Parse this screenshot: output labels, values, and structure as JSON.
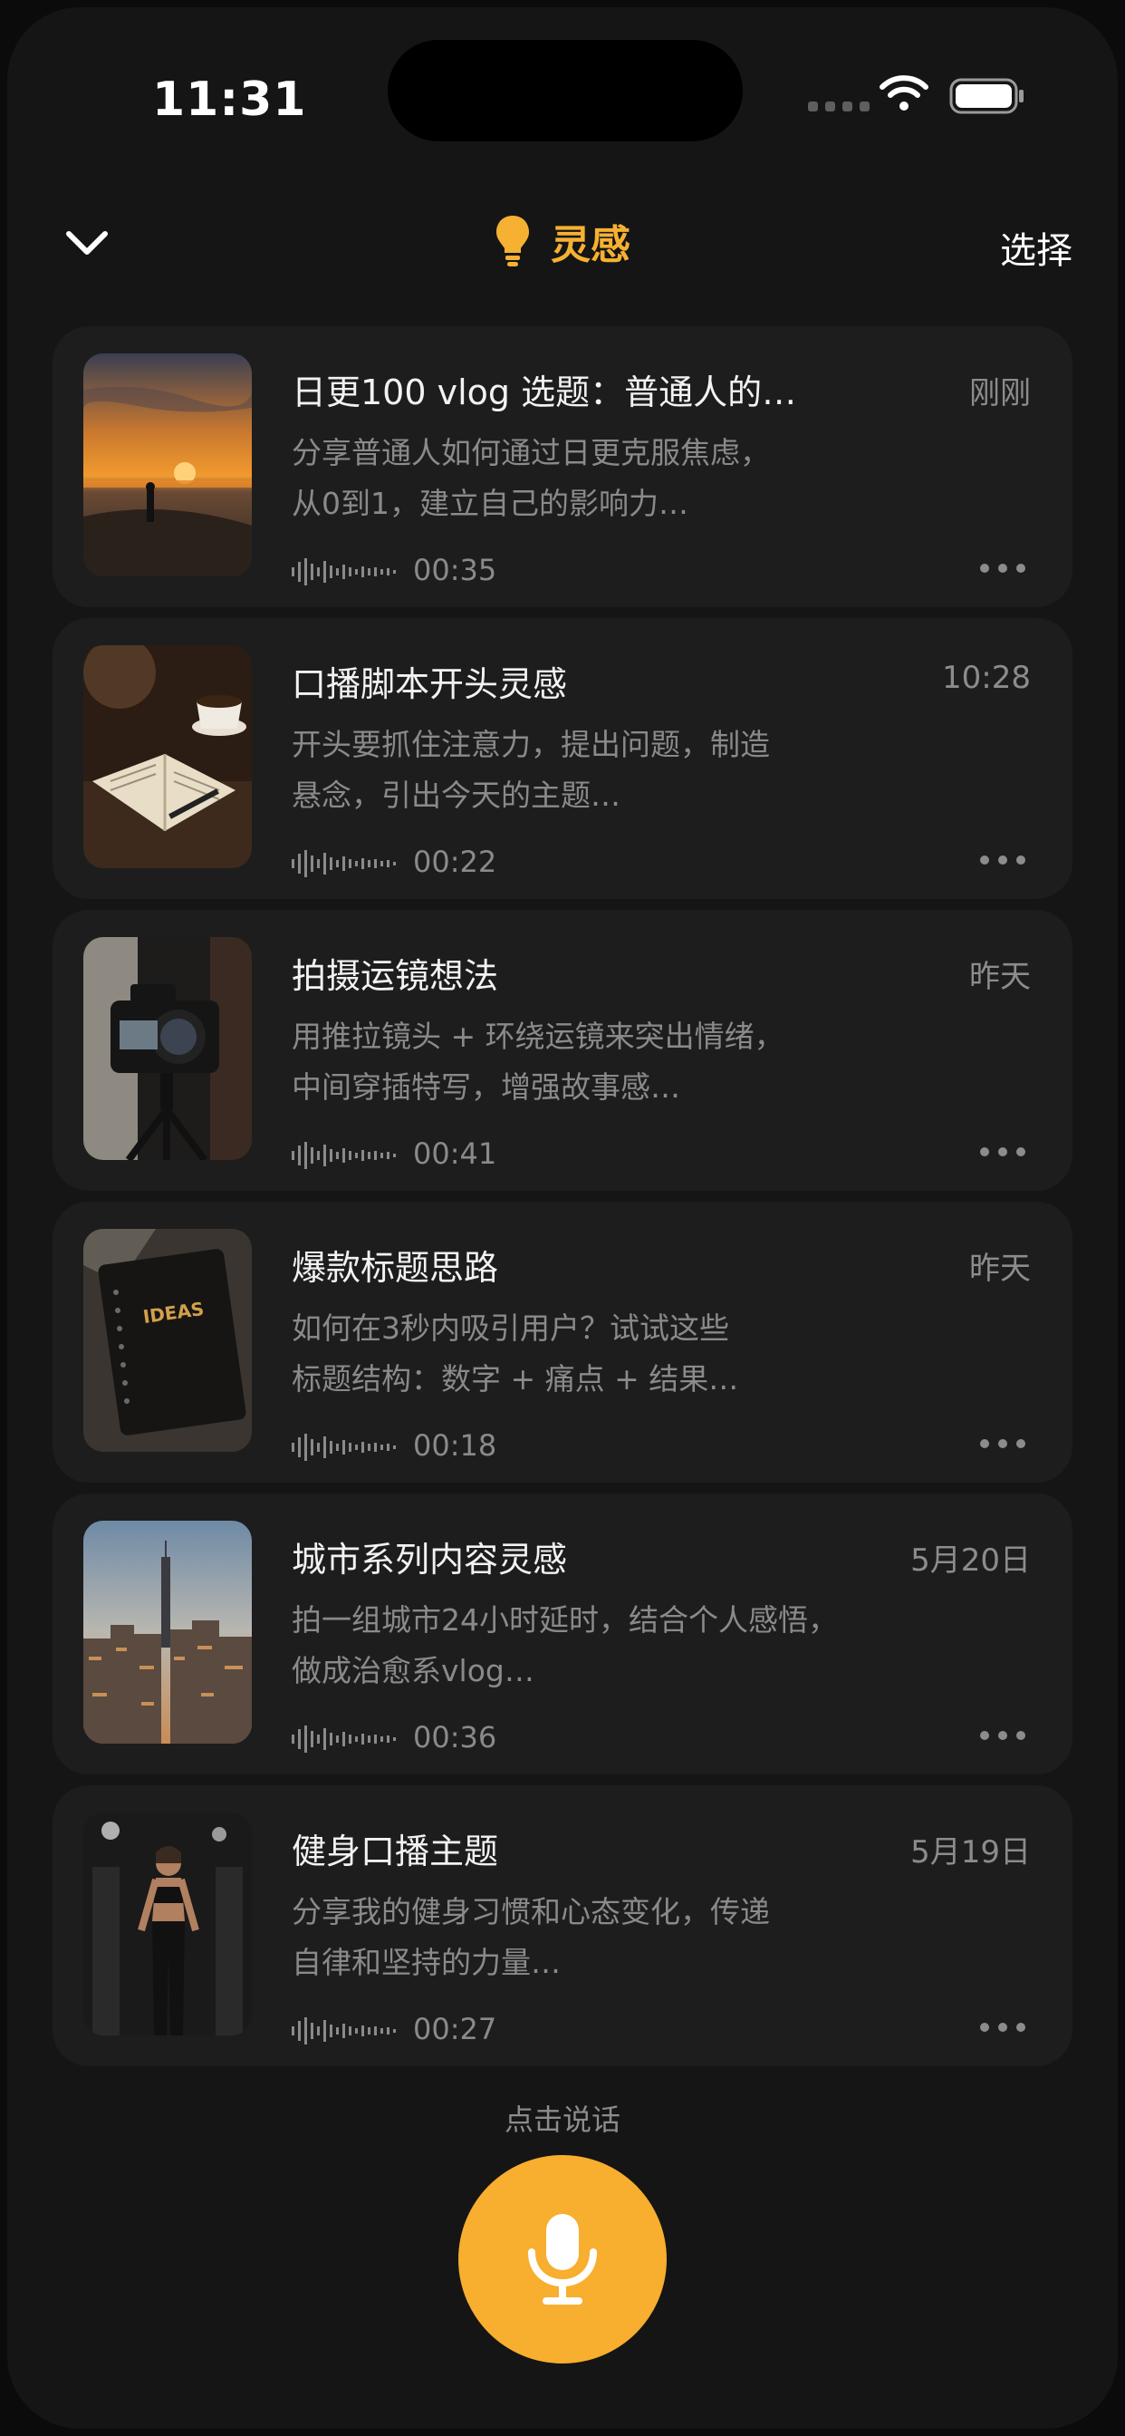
{
  "status_bar": {
    "time": "11:31"
  },
  "nav": {
    "back_icon": "chevron-down-icon",
    "title_icon": "lightbulb-icon",
    "title": "灵感",
    "action": "选择"
  },
  "notes": [
    {
      "title": "日更100 vlog 选题：普通人的…",
      "date": "刚刚",
      "desc_line1": "分享普通人如何通过日更克服焦虑，",
      "desc_line2": "从0到1，建立自己的影响力…",
      "duration": "00:35",
      "thumb": "sunset-beach"
    },
    {
      "title": "口播脚本开头灵感",
      "date": "10:28",
      "desc_line1": "开头要抓住注意力，提出问题，制造",
      "desc_line2": "悬念，引出今天的主题…",
      "duration": "00:22",
      "thumb": "notebook-coffee"
    },
    {
      "title": "拍摄运镜想法",
      "date": "昨天",
      "desc_line1": "用推拉镜头 + 环绕运镜来突出情绪，",
      "desc_line2": "中间穿插特写，增强故事感…",
      "duration": "00:41",
      "thumb": "camera-tripod"
    },
    {
      "title": "爆款标题思路",
      "date": "昨天",
      "desc_line1": "如何在3秒内吸引用户？试试这些",
      "desc_line2": "标题结构：数字 + 痛点 + 结果…",
      "duration": "00:18",
      "thumb": "ideas-notebook",
      "thumb_text": "IDEAS"
    },
    {
      "title": "城市系列内容灵感",
      "date": "5月20日",
      "desc_line1": "拍一组城市24小时延时，结合个人感悟，",
      "desc_line2": "做成治愈系vlog…",
      "duration": "00:36",
      "thumb": "city-skyline"
    },
    {
      "title": "健身口播主题",
      "date": "5月19日",
      "desc_line1": "分享我的健身习惯和心态变化，传递",
      "desc_line2": "自律和坚持的力量…",
      "duration": "00:27",
      "thumb": "gym-portrait"
    }
  ],
  "record": {
    "hint": "点击说话",
    "icon": "microphone-icon"
  },
  "colors": {
    "accent": "#f8ae2e",
    "background": "#151515",
    "card": "#1d1d1d"
  }
}
